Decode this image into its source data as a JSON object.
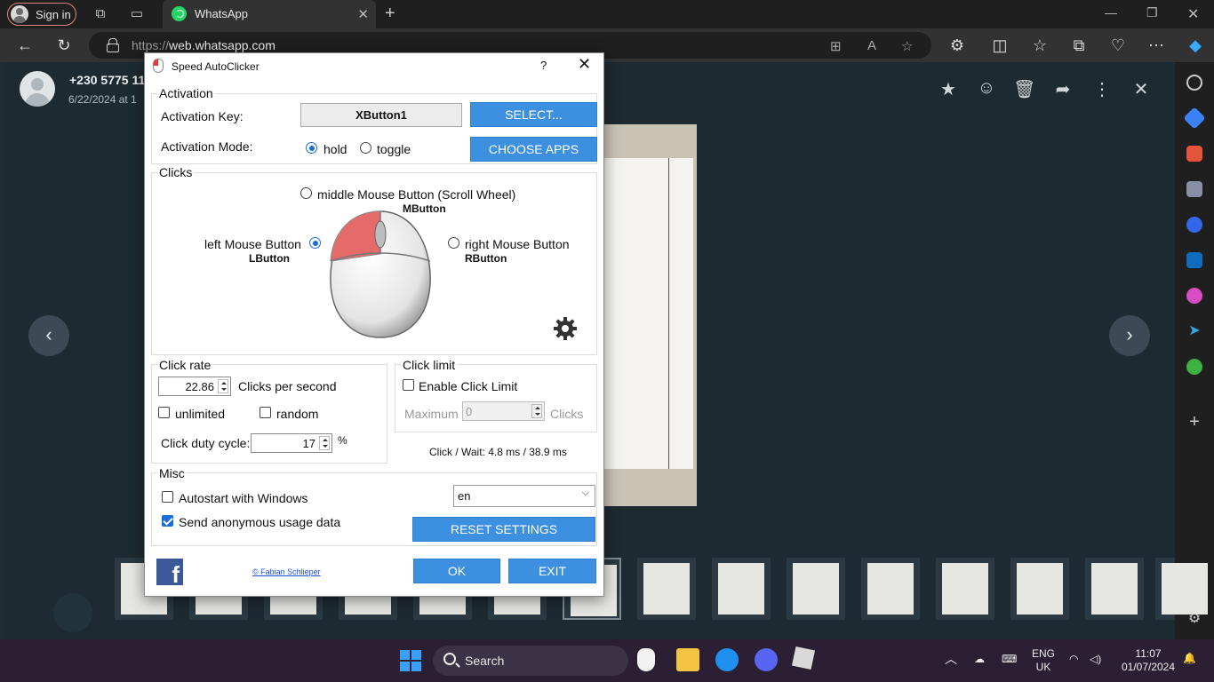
{
  "browser": {
    "signin_label": "Sign in",
    "tab_title": "WhatsApp",
    "url_prefix": "https://",
    "url_host": "web.whatsapp.com"
  },
  "viewer": {
    "contact_name": "+230 5775 11",
    "contact_date": "6/22/2024 at 1"
  },
  "dialog": {
    "title": "Speed AutoClicker",
    "help": "?",
    "close": "✕",
    "activation": {
      "group_title": "Activation",
      "key_label": "Activation Key:",
      "key_value": "XButton1",
      "select_button": "SELECT...",
      "mode_label": "Activation Mode:",
      "mode_hold": "hold",
      "mode_toggle": "toggle",
      "selected_mode": "hold",
      "choose_apps_button": "CHOOSE APPS"
    },
    "clicks": {
      "group_title": "Clicks",
      "middle_label": "middle Mouse Button (Scroll Wheel)",
      "middle_code": "MButton",
      "left_label": "left Mouse Button",
      "left_code": "LButton",
      "right_label": "right Mouse Button",
      "right_code": "RButton",
      "selected_button": "left"
    },
    "rate": {
      "group_title": "Click rate",
      "value": "22.86",
      "unit": "Clicks per second",
      "unlimited_label": "unlimited",
      "random_label": "random",
      "duty_label": "Click duty cycle:",
      "duty_value": "17",
      "duty_unit": "%"
    },
    "limit": {
      "group_title": "Click limit",
      "enable_label": "Enable Click Limit",
      "maximum_label": "Maximum",
      "maximum_value": "0",
      "clicks_label": "Clicks",
      "wait_text": "Click / Wait: 4.8 ms / 38.9 ms"
    },
    "misc": {
      "group_title": "Misc",
      "autostart_label": "Autostart with Windows",
      "autostart_checked": false,
      "usage_label": "Send anonymous usage data",
      "usage_checked": true,
      "language": "en",
      "reset_button": "RESET SETTINGS"
    },
    "footer": {
      "credit": "© Fabian Schlieper",
      "ok_button": "OK",
      "exit_button": "EXIT"
    }
  },
  "taskbar": {
    "search_label": "Search",
    "lang_line1": "ENG",
    "lang_line2": "UK",
    "time": "11:07",
    "date": "01/07/2024"
  },
  "colors": {
    "accent_blue": "#3d8fe0",
    "whatsapp_green": "#25d366",
    "viewer_bg": "#1e2a31"
  }
}
